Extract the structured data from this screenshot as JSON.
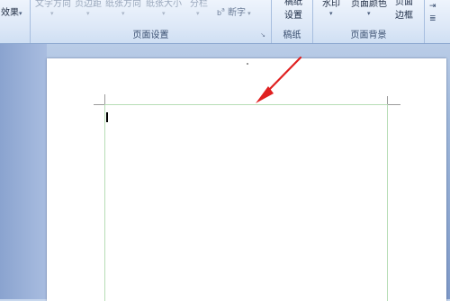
{
  "ribbon": {
    "far_left": {
      "effects_label": "效果",
      "dropdown_arrow": "▾"
    },
    "page_setup": {
      "group_label": "页面设置",
      "text_direction": "文字方向",
      "margins": "页边距",
      "orientation": "纸张方向",
      "paper_size": "纸张大小",
      "columns": "分栏",
      "hyphenation": "断字",
      "dialog_launcher": "↘"
    },
    "manuscript": {
      "group_label": "稿纸",
      "manuscript_settings_line1": "稿纸",
      "manuscript_settings_line2": "设置"
    },
    "page_background": {
      "group_label": "页面背景",
      "watermark": "水印",
      "page_color": "页面颜色",
      "page_borders_line1": "页面",
      "page_borders_line2": "边框"
    }
  },
  "colors": {
    "annotation_arrow": "#e02020",
    "margin_guides": "#b7ddb6",
    "ribbon_bg": "#dde8f7"
  }
}
